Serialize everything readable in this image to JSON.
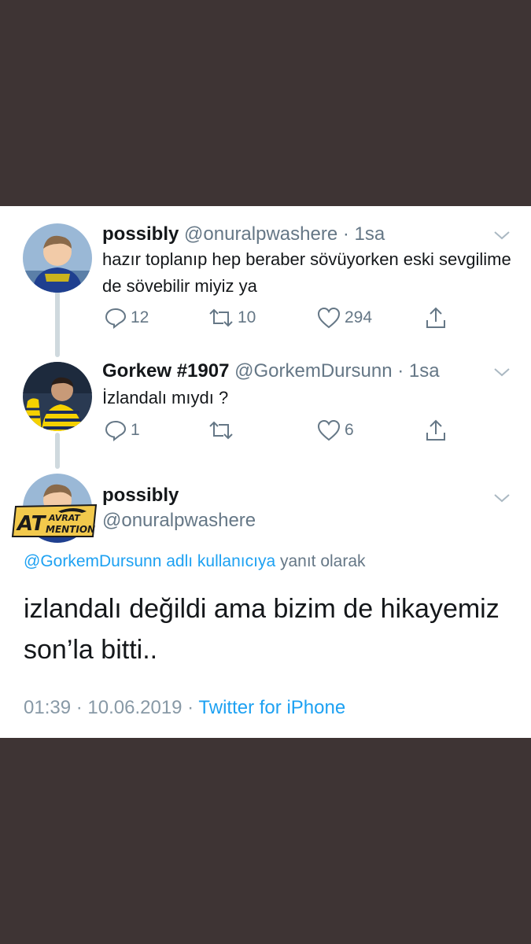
{
  "tweets": [
    {
      "name": "possibly",
      "handle": "@onuralpwashere",
      "sep": "·",
      "time": "1sa",
      "text": "hazır toplanıp hep beraber sövüyorken eski sevgilime de sövebilir miyiz ya",
      "replies": "12",
      "retweets": "10",
      "likes": "294"
    },
    {
      "name": "Gorkew #1907",
      "handle": "@GorkemDursunn",
      "sep": "·",
      "time": "1sa",
      "text": "İzlandalı mıydı ?",
      "replies": "1",
      "retweets": "",
      "likes": "6"
    }
  ],
  "main_tweet": {
    "name": "possibly",
    "handle": "@onuralpwashere",
    "reply_link": "@GorkemDursunn adlı kullanıcıya",
    "reply_suffix": " yanıt olarak",
    "text_line1": "izlandalı değildi ama bizim de hikayemiz",
    "text_line2": "son’la bitti..",
    "time": "01:39",
    "dot": " · ",
    "date": "10.06.2019",
    "source": "Twitter for iPhone"
  },
  "watermark": {
    "text_big": "AT",
    "text_top": "AVRAT",
    "text_bottom": "MENTION"
  },
  "colors": {
    "background": "#3e3434",
    "card": "#ffffff",
    "accent": "#1da1f2",
    "muted": "#657786"
  }
}
